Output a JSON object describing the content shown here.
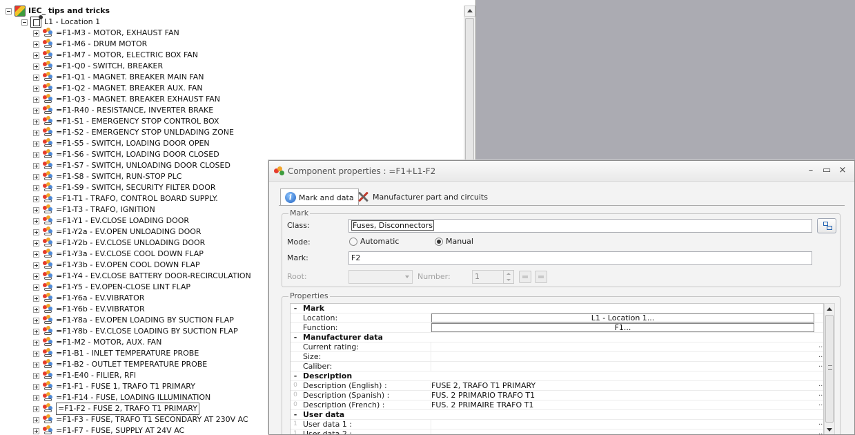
{
  "tree": {
    "root": {
      "label": "IEC_ tips and tricks"
    },
    "location": {
      "label": "L1 - Location 1"
    },
    "items": [
      "=F1-M3 - MOTOR, EXHAUST FAN",
      "=F1-M6 - DRUM MOTOR",
      "=F1-M7 - MOTOR, ELECTRIC BOX FAN",
      "=F1-Q0 - SWITCH, BREAKER",
      "=F1-Q1 - MAGNET. BREAKER MAIN FAN",
      "=F1-Q2 - MAGNET. BREAKER AUX. FAN",
      "=F1-Q3 - MAGNET. BREAKER EXHAUST FAN",
      "=F1-R40 - RESISTANCE, INVERTER BRAKE",
      "=F1-S1 - EMERGENCY STOP CONTROL BOX",
      "=F1-S2 - EMERGENCY STOP UNLDADING ZONE",
      "=F1-S5 - SWITCH, LOADING DOOR OPEN",
      "=F1-S6 - SWITCH, LOADING DOOR CLOSED",
      "=F1-S7 - SWITCH, UNLOADING DOOR CLOSED",
      "=F1-S8 - SWITCH, RUN-STOP PLC",
      "=F1-S9 - SWITCH, SECURITY FILTER DOOR",
      "=F1-T1 - TRAFO, CONTROL BOARD SUPPLY.",
      "=F1-T3 - TRAFO, IGNITION",
      "=F1-Y1 - EV.CLOSE LOADING DOOR",
      "=F1-Y2a - EV.OPEN UNLOADING DOOR",
      "=F1-Y2b  - EV.CLOSE UNLOADING DOOR",
      "=F1-Y3a - EV.CLOSE COOL DOWN FLAP",
      "=F1-Y3b - EV.OPEN COOL DOWN FLAP",
      "=F1-Y4 - EV.CLOSE BATTERY DOOR-RECIRCULATION",
      "=F1-Y5 - EV.OPEN-CLOSE LINT FLAP",
      "=F1-Y6a - EV.VIBRATOR",
      "=F1-Y6b - EV.VIBRATOR",
      "=F1-Y8a - EV.OPEN LOADING BY SUCTION FLAP",
      "=F1-Y8b - EV.CLOSE LOADING BY SUCTION FLAP",
      "=F1-M2 - MOTOR, AUX. FAN",
      "=F1-B1 - INLET TEMPERATURE PROBE",
      "=F1-B2 - OUTLET TEMPERATURE PROBE",
      "=F1-E40 - FILIER, RFI",
      "=F1-F1 - FUSE 1, TRAFO T1 PRIMARY",
      "=F1-F14 - FUSE, LOADING ILLUMINATION",
      "=F1-F2 - FUSE 2, TRAFO T1 PRIMARY",
      "=F1-F3 - FUSE, TRAFO T1 SECONDARY AT 230V AC",
      "=F1-F7 - FUSE, SUPPLY AT 24V AC"
    ],
    "selected_index": 34
  },
  "dialog": {
    "title": "Component properties : =F1+L1-F2",
    "tabs": [
      "Mark and data",
      "Manufacturer part and circuits"
    ],
    "mark_group": {
      "legend": "Mark",
      "class_label": "Class:",
      "class_value": "Fuses, Disconnectors",
      "mode_label": "Mode:",
      "mode_automatic": "Automatic",
      "mode_manual": "Manual",
      "mode_selected": "Manual",
      "mark_label": "Mark:",
      "mark_value": "F2",
      "root_label": "Root:",
      "number_label": "Number:",
      "number_value": "1"
    },
    "properties": {
      "legend": "Properties",
      "rows": [
        {
          "type": "category",
          "name": "Mark",
          "gutter": "-"
        },
        {
          "type": "prop",
          "name": "Location:",
          "value": "L1 - Location 1...",
          "boxed": true
        },
        {
          "type": "prop",
          "name": "Function:",
          "value": "F1...",
          "boxed": true
        },
        {
          "type": "category",
          "name": "Manufacturer data",
          "gutter": "-"
        },
        {
          "type": "prop",
          "name": "Current rating:",
          "value": "",
          "ellipsis": "..."
        },
        {
          "type": "prop",
          "name": "Size:",
          "value": "",
          "ellipsis": "..."
        },
        {
          "type": "prop",
          "name": "Caliber:",
          "value": "",
          "ellipsis": "..."
        },
        {
          "type": "category",
          "name": "Description",
          "gutter": "-"
        },
        {
          "type": "prop",
          "name": "Description (English) :",
          "value": "FUSE 2, TRAFO T1 PRIMARY",
          "gutter": "0",
          "ellipsis": "..."
        },
        {
          "type": "prop",
          "name": "Description (Spanish) :",
          "value": "FUS. 2 PRIMARIO TRAFO T1",
          "gutter": "0",
          "ellipsis": "..."
        },
        {
          "type": "prop",
          "name": "Description (French) :",
          "value": "FUS. 2 PRIMAIRE TRAFO T1",
          "gutter": "0",
          "ellipsis": "..."
        },
        {
          "type": "category",
          "name": "User data",
          "gutter": "-"
        },
        {
          "type": "prop",
          "name": "User data 1 :",
          "value": "",
          "gutter": "1",
          "ellipsis": "..."
        },
        {
          "type": "prop",
          "name": "User data 2 :",
          "value": "",
          "gutter": "1",
          "ellipsis": "..."
        }
      ]
    }
  }
}
